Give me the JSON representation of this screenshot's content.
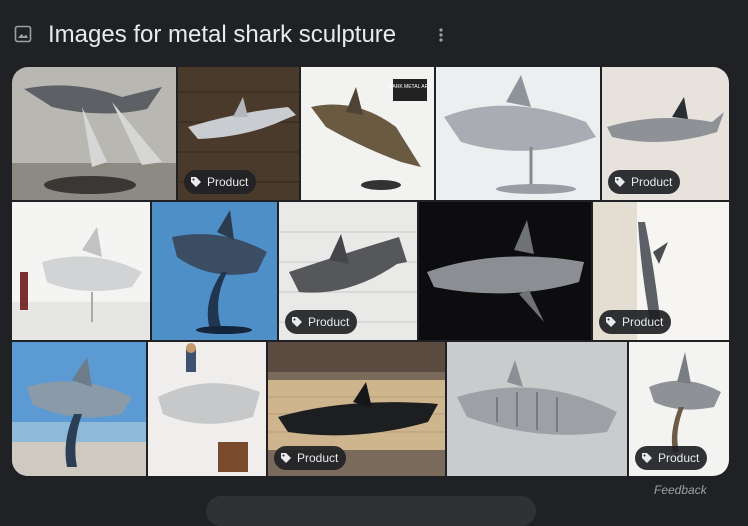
{
  "header": {
    "title": "Images for metal shark sculpture",
    "icon": "image-icon",
    "menu_icon": "more-vert-icon"
  },
  "tiles": [
    {
      "name": "r1-1",
      "badge": ""
    },
    {
      "name": "r1-2",
      "badge": "Product"
    },
    {
      "name": "r1-3",
      "badge": "",
      "logo_text": "DARK METAL ART"
    },
    {
      "name": "r1-4",
      "badge": ""
    },
    {
      "name": "r1-5",
      "badge": "Product"
    },
    {
      "name": "r2-1",
      "badge": ""
    },
    {
      "name": "r2-2",
      "badge": ""
    },
    {
      "name": "r2-3",
      "badge": "Product"
    },
    {
      "name": "r2-4",
      "badge": ""
    },
    {
      "name": "r2-5",
      "badge": "Product"
    },
    {
      "name": "r3-1",
      "badge": ""
    },
    {
      "name": "r3-2",
      "badge": ""
    },
    {
      "name": "r3-3",
      "badge": "Product"
    },
    {
      "name": "r3-4",
      "badge": ""
    },
    {
      "name": "r3-5",
      "badge": "Product"
    }
  ],
  "footer": {
    "feedback": "Feedback"
  },
  "colors": {
    "background": "#202124",
    "text": "#e8eaed",
    "muted": "#9aa0a6"
  }
}
